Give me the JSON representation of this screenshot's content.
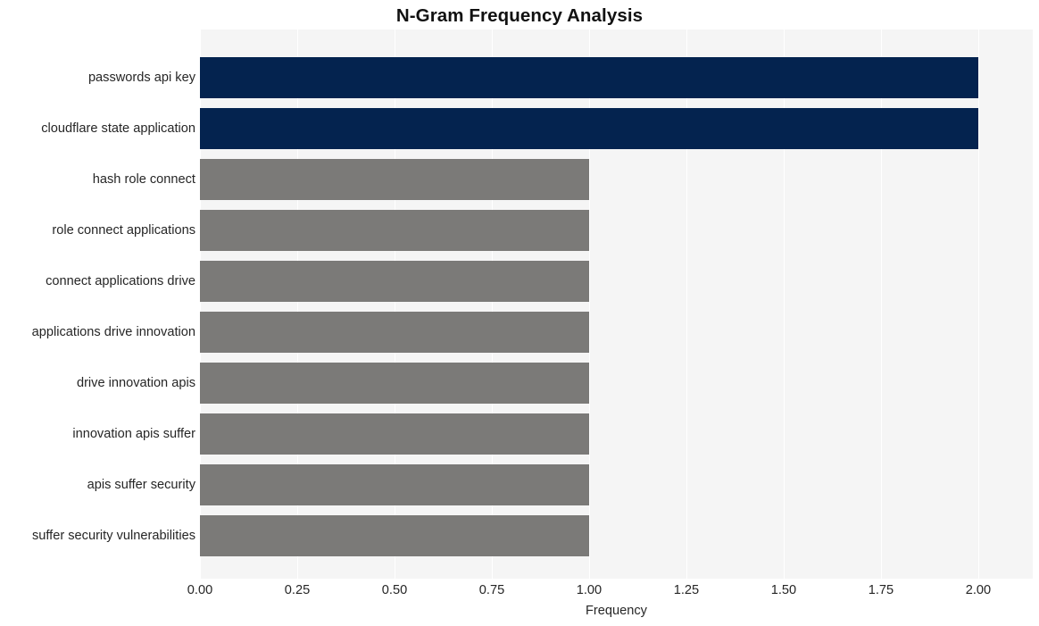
{
  "chart_data": {
    "type": "bar",
    "orientation": "horizontal",
    "title": "N-Gram Frequency Analysis",
    "xlabel": "Frequency",
    "ylabel": "",
    "categories": [
      "passwords api key",
      "cloudflare state application",
      "hash role connect",
      "role connect applications",
      "connect applications drive",
      "applications drive innovation",
      "drive innovation apis",
      "innovation apis suffer",
      "apis suffer security",
      "suffer security vulnerabilities"
    ],
    "values": [
      2,
      2,
      1,
      1,
      1,
      1,
      1,
      1,
      1,
      1
    ],
    "bar_colors": [
      "#04234f",
      "#04234f",
      "#7b7a78",
      "#7b7a78",
      "#7b7a78",
      "#7b7a78",
      "#7b7a78",
      "#7b7a78",
      "#7b7a78",
      "#7b7a78"
    ],
    "xlim": [
      0,
      2.14
    ],
    "xticks": [
      0,
      0.25,
      0.5,
      0.75,
      1,
      1.25,
      1.5,
      1.75,
      2
    ],
    "xtick_labels": [
      "0.00",
      "0.25",
      "0.50",
      "0.75",
      "1.00",
      "1.25",
      "1.50",
      "1.75",
      "2.00"
    ],
    "grid": true,
    "grid_axis": "x",
    "grid_color": "#ffffff",
    "legend": null,
    "plot_background": "#f5f5f5",
    "figure_background": "#ffffff",
    "highlight_color": "#04234f",
    "default_color": "#7b7a78"
  }
}
